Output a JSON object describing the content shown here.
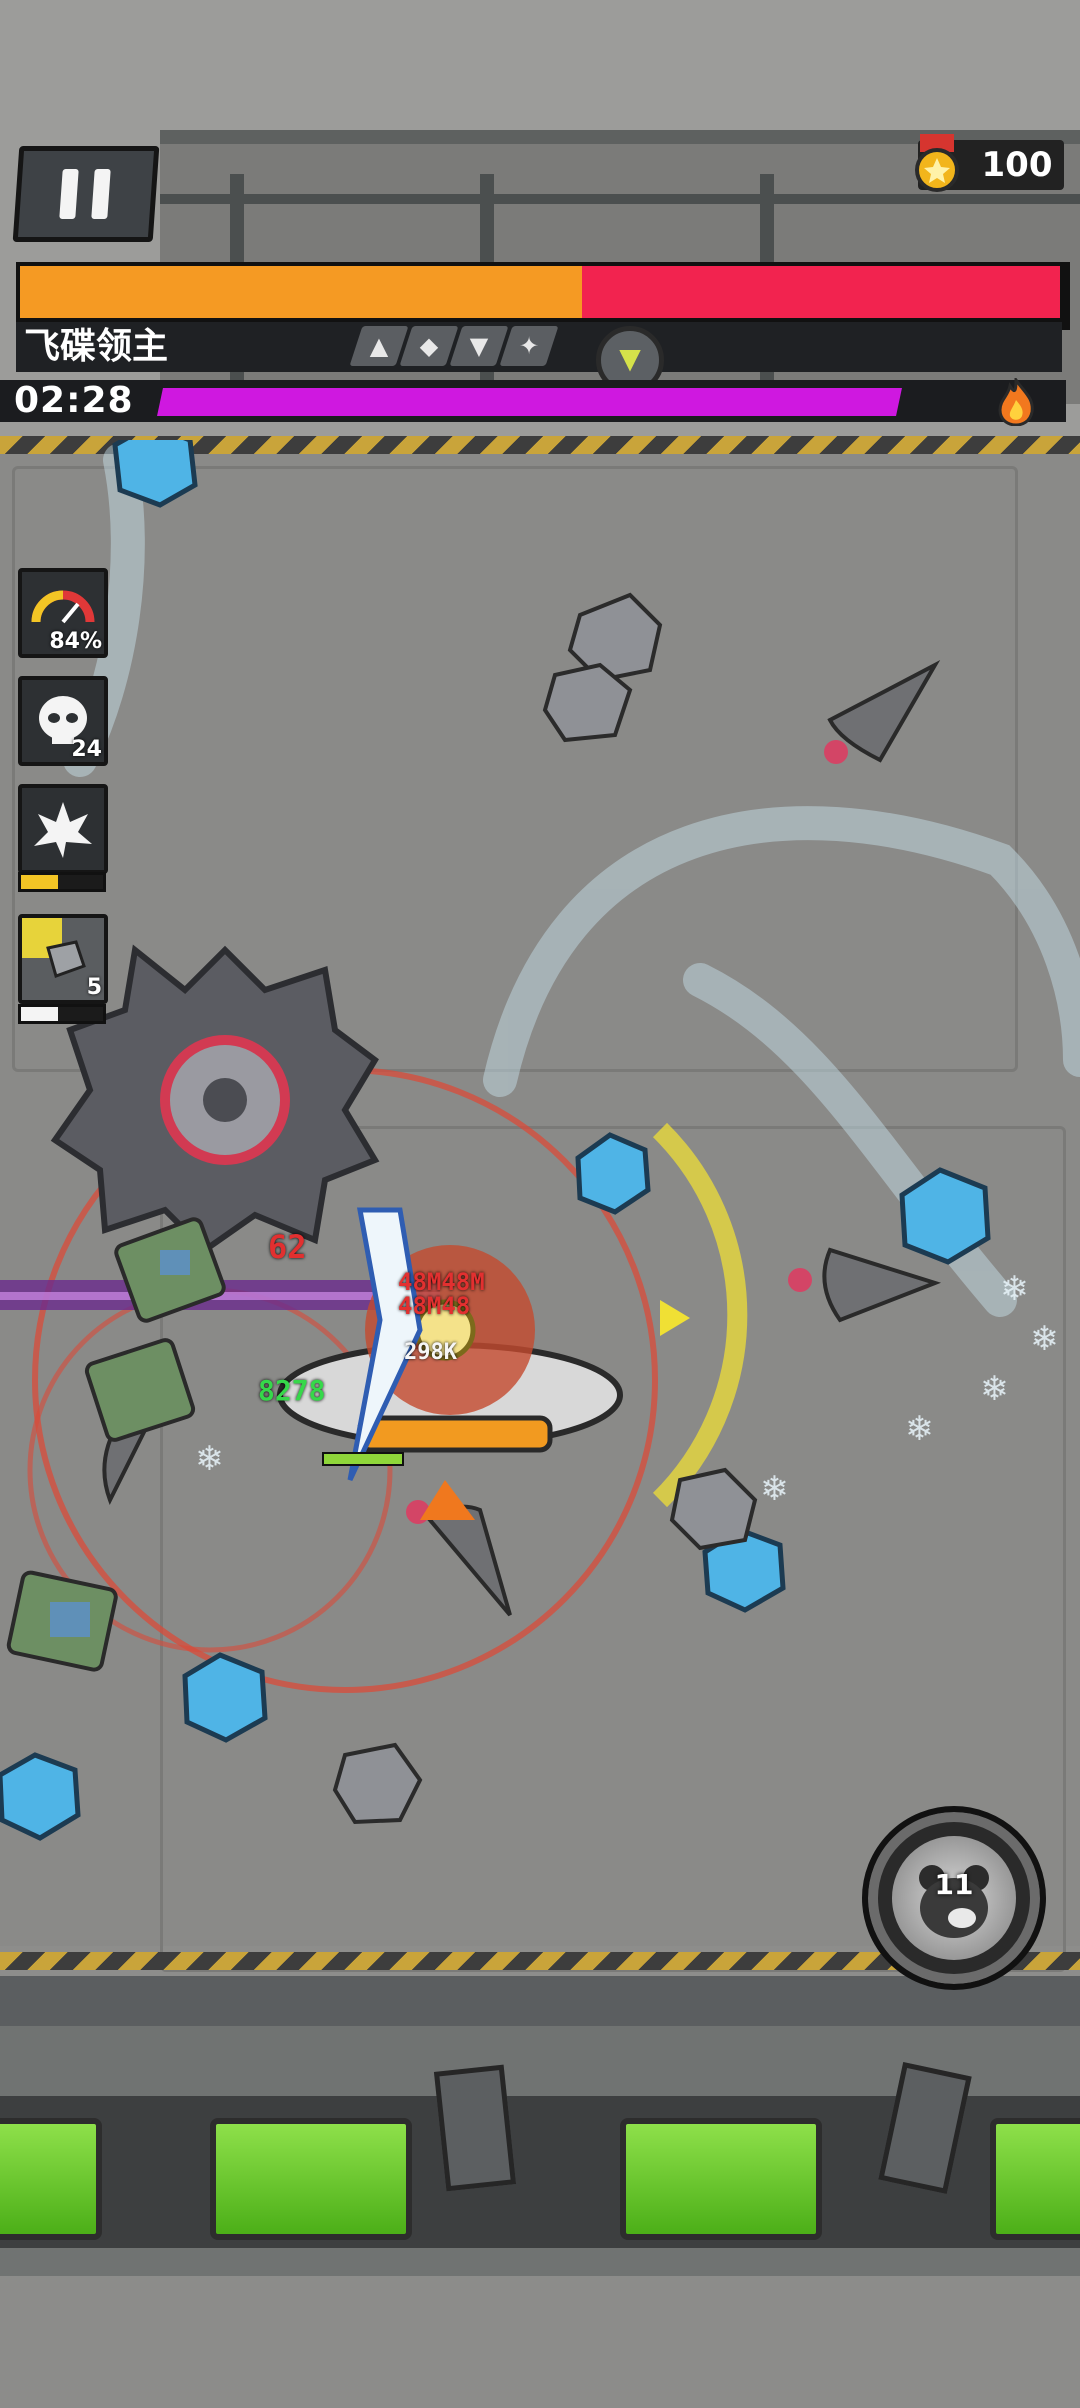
{
  "hud": {
    "medal_count": "100",
    "boss_name": "飞碟领主",
    "boss_health_fraction": 0.54,
    "timer": "02:28",
    "exp_fraction": 0.96
  },
  "status_icons": [
    {
      "name": "speed-gauge",
      "value": "84%"
    },
    {
      "name": "skull-kills",
      "value": "24"
    },
    {
      "name": "explosion-skill",
      "charge_fraction": 0.45
    },
    {
      "name": "drone-skill",
      "value": "5",
      "charge_fraction": 0.45
    }
  ],
  "boss_skill_icons": [
    "spike-icon",
    "shield-icon",
    "arrow-down-icon",
    "burst-icon"
  ],
  "ultimate": {
    "count": "11"
  },
  "damage_numbers": [
    "62",
    "48M48M",
    "48M48",
    "298K",
    "8278"
  ],
  "colors": {
    "boss_orange": "#f59a23",
    "boss_red": "#f2234f",
    "exp_purple": "#cf18e0",
    "hud_dark": "#1f2124",
    "tube_green": "#6fd030"
  }
}
